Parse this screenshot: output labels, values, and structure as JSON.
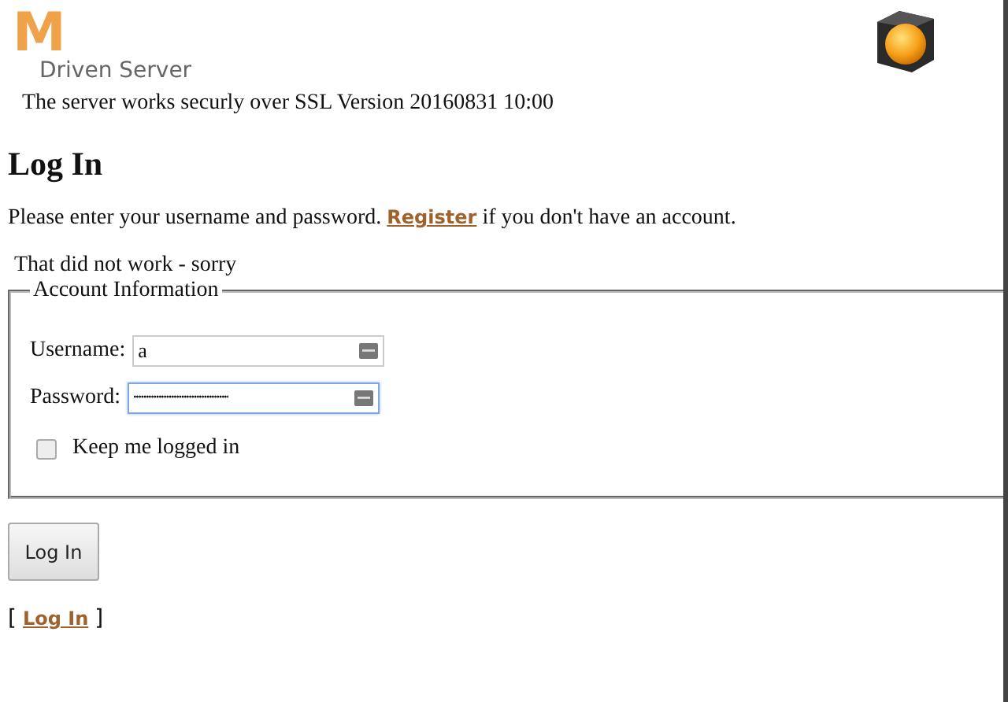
{
  "header": {
    "logo_letter": "M",
    "logo_text": "Driven Server",
    "tagline": "The server works securly over SSL Version 20160831 10:00"
  },
  "title": "Log In",
  "intro": {
    "before": "Please enter your username and password.",
    "link": "Register",
    "after": "if you don't have an account."
  },
  "error": "That did not work - sorry",
  "fieldset": {
    "legend": "Account Information",
    "fields": [
      {
        "kind": "text",
        "label": "Username:",
        "value": "a",
        "focused": false
      },
      {
        "kind": "password",
        "label": "Password:",
        "value": "••••••••••••••••••••••••••••••••••••••",
        "focused": true
      }
    ],
    "checkbox": {
      "label": "Keep me logged in",
      "checked": false
    }
  },
  "button": "Log In",
  "footer": {
    "open": "[",
    "link": "Log In",
    "close": "]"
  }
}
